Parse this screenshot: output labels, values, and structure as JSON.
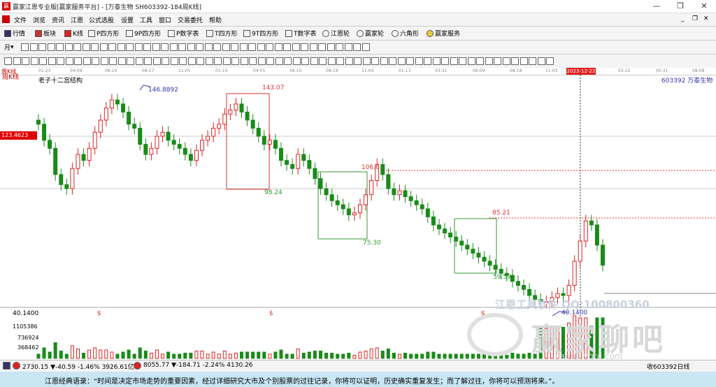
{
  "window": {
    "title": "赢家江恩专业版[赢家服务平台] - [万泰生物  SH603392-184周K线]",
    "min": "—",
    "max": "❐",
    "close": "✕"
  },
  "menu": {
    "items": [
      "文件",
      "浏览",
      "资讯",
      "江恩",
      "公式选股",
      "设置",
      "工具",
      "窗口",
      "交易委托",
      "帮助"
    ],
    "right": [
      "_",
      "❐",
      "✕"
    ]
  },
  "toolbar1": {
    "items": [
      "行情",
      "板块",
      "K线",
      "P四方形",
      "9P四方形",
      "P数字表",
      "T四方形",
      "9T四方形",
      "T数字表",
      "江恩轮",
      "赢家轮",
      "六角形",
      "赢家服务"
    ]
  },
  "toolbar2": {
    "period": "月"
  },
  "axis_dates": [
    "01-23",
    "04-09",
    "06-10",
    "08-27",
    "11-05",
    "01-14",
    "04-01",
    "06-10",
    "08-19",
    "11-04",
    "01-13",
    "03-31",
    "06-09",
    "08-18",
    "11-03",
    "2023-12-22",
    "03-22",
    "05-31",
    "08-08"
  ],
  "chart": {
    "period_label": "周K线",
    "study_label": "老子十二宫结构",
    "code_label": "603392  万泰生物",
    "price_tag": "123.4623",
    "annotations": {
      "high1": "146.8892",
      "box1_high": "143.07",
      "box1_low": "98.24",
      "box2_high": "106.6",
      "box2_low": "75.30",
      "box3_high": "85.21",
      "box3_low": "59.59",
      "low": "40.1400",
      "yaxis_low": "40.1400",
      "dollar": "$"
    },
    "vol_ticks": [
      "1105386",
      "736924",
      "368462"
    ]
  },
  "watermark": {
    "line1": "江恩工具软件  QQ:100800360",
    "line2": "赢家聊吧",
    "line3": "jiaoba.yqtd.com"
  },
  "status": {
    "sh": "2730.15 ▼-40.59 -1.46% 3926.61亿",
    "sz": "8055.77 ▼-184.71 -2.24% 4130.26",
    "right": "收603392日线"
  },
  "quote": "江恩经典语录：“时间是决定市场走势的重要因素，经过详细研究大市及个别股票的过往记录，你将可以证明，历史确实重复发生；而了解过往，你将可以预测将来。”。",
  "chart_data": {
    "type": "candlestick",
    "symbol": "603392",
    "close_series_approx": [
      130,
      122,
      118,
      105,
      100,
      98,
      108,
      115,
      112,
      118,
      126,
      132,
      138,
      142,
      140,
      136,
      130,
      128,
      120,
      115,
      118,
      124,
      126,
      122,
      120,
      118,
      115,
      112,
      117,
      122,
      124,
      128,
      130,
      135,
      137,
      140,
      136,
      132,
      128,
      124,
      120,
      122,
      118,
      112,
      110,
      108,
      115,
      112,
      108,
      103,
      98,
      95,
      92,
      90,
      88,
      85,
      86,
      90,
      95,
      102,
      110,
      105,
      98,
      95,
      97,
      94,
      92,
      90,
      88,
      84,
      80,
      78,
      76,
      74,
      72,
      70,
      68,
      66,
      64,
      62,
      60,
      58,
      56,
      55,
      52,
      50,
      48,
      45,
      43,
      42,
      42,
      44,
      46,
      45,
      50,
      62,
      72,
      82,
      80,
      70,
      60
    ],
    "ylim": [
      40.14,
      146.8892
    ]
  }
}
